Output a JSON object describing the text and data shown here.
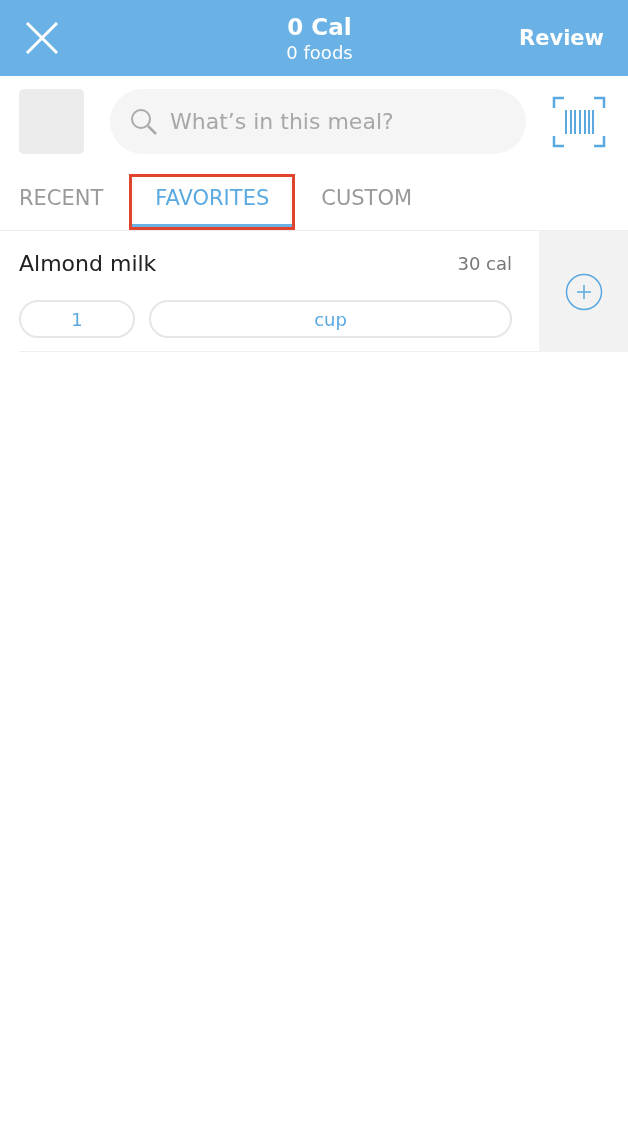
{
  "header": {
    "calories": "0 Cal",
    "foods": "0 foods",
    "action": "Review"
  },
  "search": {
    "placeholder": "What’s in this meal?"
  },
  "tabs": [
    {
      "label": "RECENT",
      "selected": false,
      "highlighted": false
    },
    {
      "label": "FAVORITES",
      "selected": true,
      "highlighted": true
    },
    {
      "label": "CUSTOM",
      "selected": false,
      "highlighted": false
    }
  ],
  "foods": [
    {
      "name": "Almond milk",
      "calories": "30 cal",
      "quantity": "1",
      "unit": "cup"
    }
  ]
}
